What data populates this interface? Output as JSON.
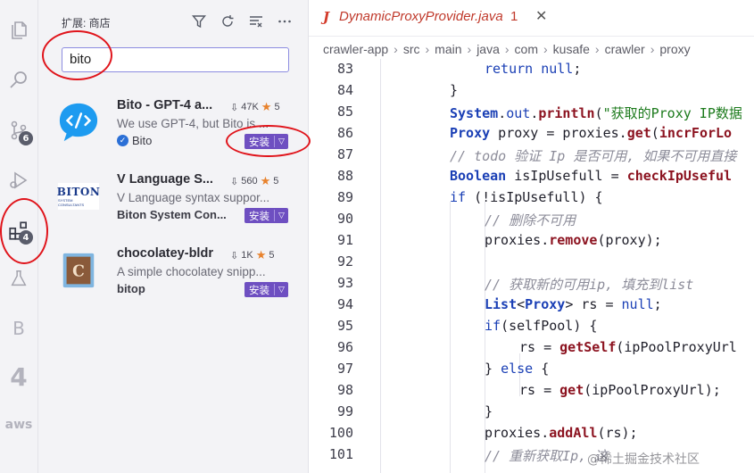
{
  "activity_bar": {
    "scm_badge": "6",
    "extensions_badge": "4",
    "bito_letter": "B",
    "tabnine_label": "4",
    "aws_label": "aws"
  },
  "sidebar": {
    "title": "扩展: 商店",
    "search_value": "bito",
    "extensions": [
      {
        "name": "Bito - GPT-4 a...",
        "downloads": "47K",
        "rating": "5",
        "description": "We use GPT-4, but Bito is ...",
        "publisher": "Bito",
        "verified": true,
        "install_label": "安装"
      },
      {
        "name": "V Language S...",
        "downloads": "560",
        "rating": "5",
        "description": "V Language syntax suppor...",
        "publisher": "Biton System Con...",
        "logo_text": "BITON",
        "logo_subtext": "SYSTEM CONSULTANTS",
        "install_label": "安装"
      },
      {
        "name": "chocolatey-bldr",
        "downloads": "1K",
        "rating": "5",
        "description": "A simple chocolatey snipp...",
        "publisher": "bitop",
        "install_label": "安装"
      }
    ]
  },
  "editor": {
    "tab_title": "DynamicProxyProvider.java",
    "tab_problems": "1",
    "breadcrumbs": [
      "crawler-app",
      "src",
      "main",
      "java",
      "com",
      "kusafe",
      "crawler",
      "proxy"
    ],
    "line_numbers": [
      "83",
      "84",
      "85",
      "86",
      "87",
      "88",
      "89",
      "90",
      "91",
      "92",
      "93",
      "94",
      "95",
      "96",
      "97",
      "98",
      "99",
      "100",
      "101"
    ]
  },
  "watermark": "@稀土掘金技术社区",
  "colors": {
    "accent_install": "#6e4fc1",
    "annotation_red": "#e0141b",
    "badge": "#5a5d6b"
  }
}
